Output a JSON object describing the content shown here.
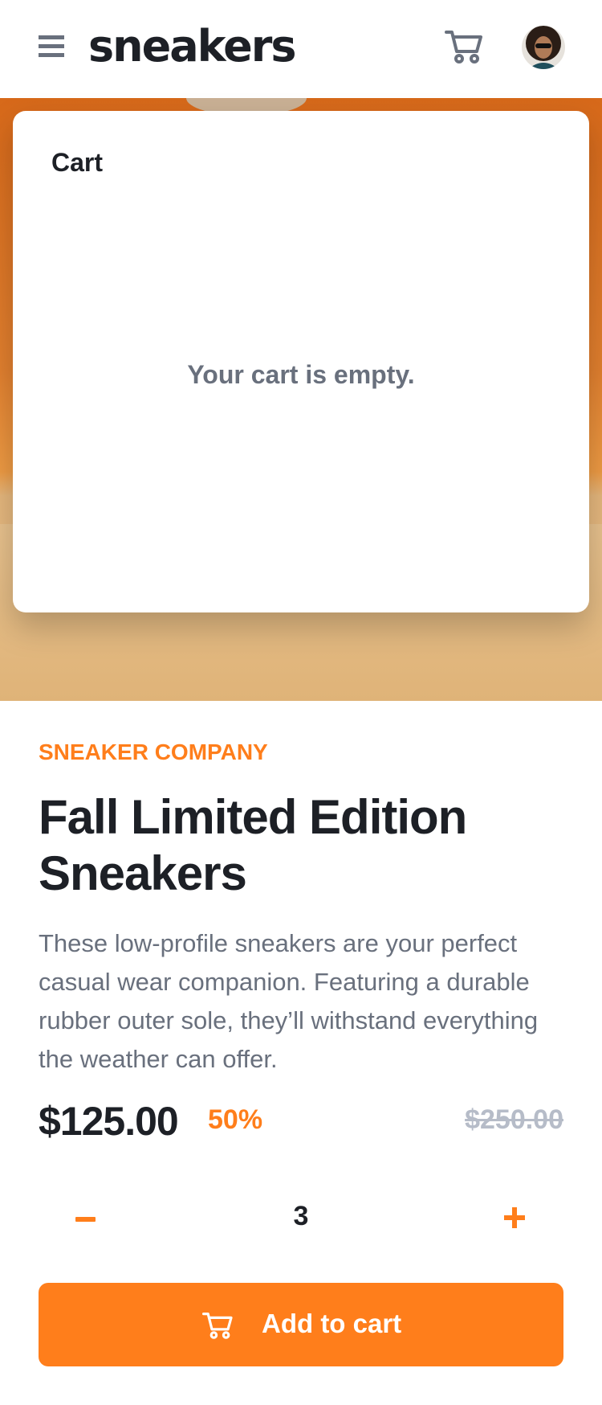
{
  "header": {
    "logo": "sneakers",
    "menu_icon": "hamburger-menu-icon",
    "cart_icon": "cart-icon",
    "avatar_alt": "user-avatar"
  },
  "cart": {
    "title": "Cart",
    "empty_message": "Your cart is empty."
  },
  "product": {
    "company": "SNEAKER COMPANY",
    "title": "Fall Limited Edition Sneakers",
    "description": "These low-profile sneakers are your perfect casual wear companion. Featuring a durable rubber outer sole, they’ll withstand everything the weather can offer.",
    "price": "$125.00",
    "discount": "50%",
    "original_price": "$250.00"
  },
  "quantity": {
    "value": "3",
    "minus_icon": "minus-icon",
    "plus_icon": "plus-icon"
  },
  "add_to_cart": {
    "label": "Add to cart",
    "icon": "cart-icon"
  },
  "colors": {
    "accent": "#ff7e1b",
    "text_dark": "#1d2026",
    "text_muted": "#69707d",
    "text_light": "#b6bcc8"
  }
}
